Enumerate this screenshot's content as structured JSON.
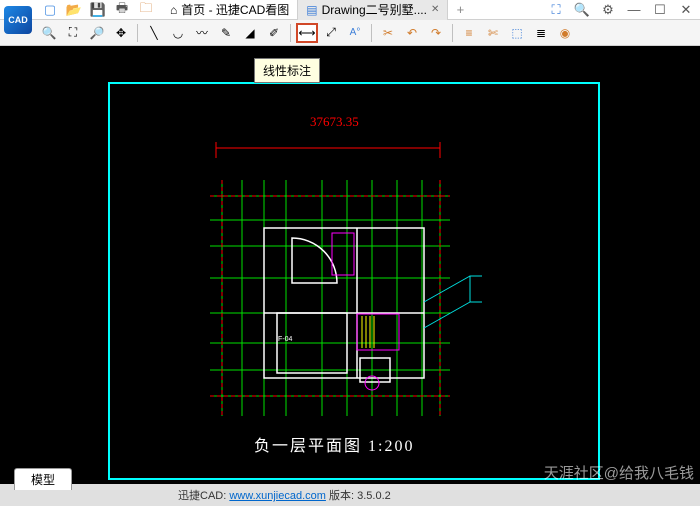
{
  "app": {
    "name": "迅捷CAD看图"
  },
  "tabs": [
    {
      "label": "首页 - 迅捷CAD看图",
      "icon": "home"
    },
    {
      "label": "Drawing二号别墅....",
      "icon": "doc",
      "active": true
    }
  ],
  "tooltip": "线性标注",
  "dimension": "37673.35",
  "plan_title": "负一层平面图  1:200",
  "model_tab": "模型",
  "status": {
    "prefix": "迅捷CAD: ",
    "link": "www.xunjiecad.com",
    "version": " 版本: 3.5.0.2"
  },
  "watermark": "天涯社区@给我八毛钱",
  "titlebar_icons": [
    "new",
    "open",
    "save",
    "print",
    "folder"
  ],
  "win_icons": [
    "expand",
    "search",
    "gear",
    "min",
    "max",
    "close"
  ],
  "toolbar_groups": [
    [
      "zoom-in",
      "zoom-fit",
      "zoom-out",
      "pan"
    ],
    [
      "line",
      "arc",
      "curve",
      "edit",
      "eraser",
      "text"
    ],
    [
      "dim-linear",
      "dim-align",
      "ann"
    ],
    [
      "trim",
      "undo",
      "redo"
    ],
    [
      "layer",
      "clip",
      "box",
      "list",
      "circle"
    ]
  ],
  "selected_tool": "dim-linear"
}
